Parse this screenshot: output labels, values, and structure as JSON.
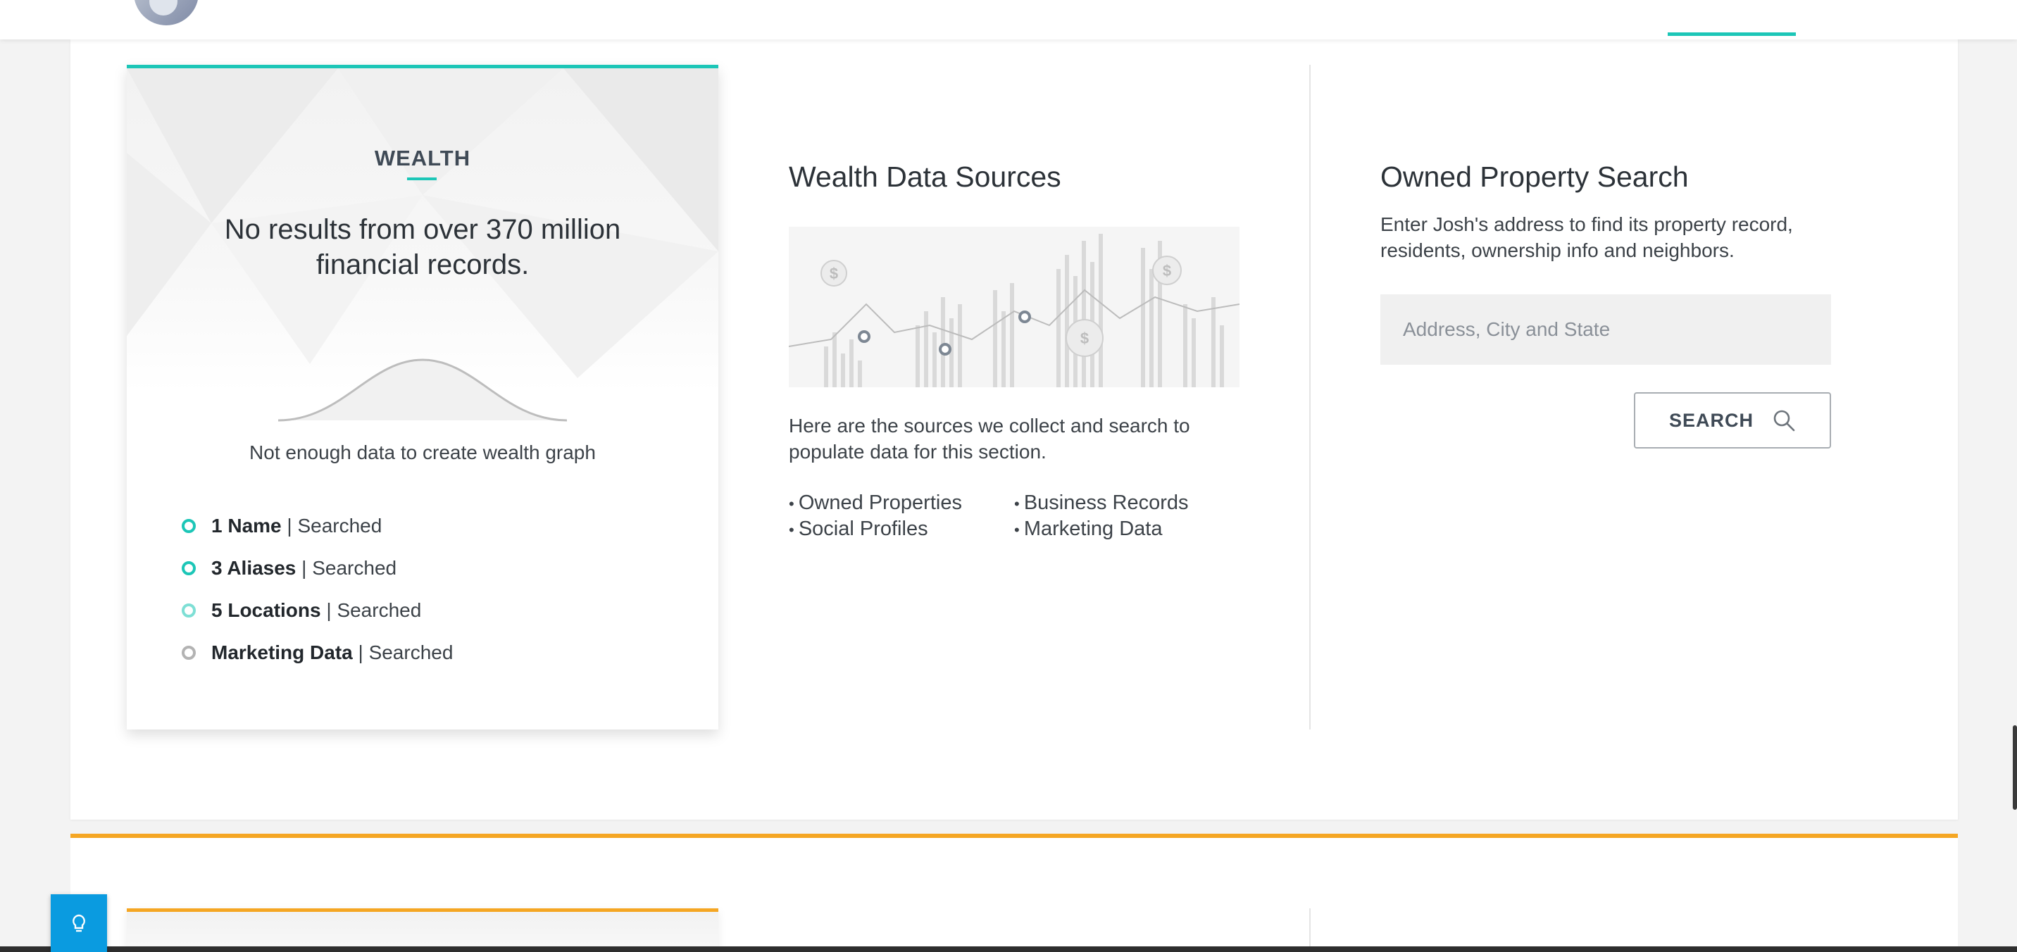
{
  "wealth_panel": {
    "title": "WEALTH",
    "headline": "No results from over 370 million financial records.",
    "graph_caption": "Not enough data to create wealth graph",
    "items": [
      {
        "label": "1 Name",
        "status": "Searched",
        "color": "#1cc6b7"
      },
      {
        "label": "3 Aliases",
        "status": "Searched",
        "color": "#1cc6b7"
      },
      {
        "label": "5 Locations",
        "status": "Searched",
        "color": "#7edfd5"
      },
      {
        "label": "Marketing Data",
        "status": "Searched",
        "color": "#b3b3b3"
      }
    ]
  },
  "sources_section": {
    "title": "Wealth Data Sources",
    "description": "Here are the sources we collect and search to populate data for this section.",
    "sources": [
      "Owned Properties",
      "Business Records",
      "Social Profiles",
      "Marketing Data"
    ]
  },
  "property_search": {
    "title": "Owned Property Search",
    "description": "Enter Josh's address to find its property record, residents, ownership info and neighbors.",
    "placeholder": "Address, City and State",
    "button_label": "SEARCH"
  },
  "colors": {
    "accent": "#1cc6b7",
    "next_section_accent": "#f5a623",
    "help_button": "#0a9be0"
  }
}
